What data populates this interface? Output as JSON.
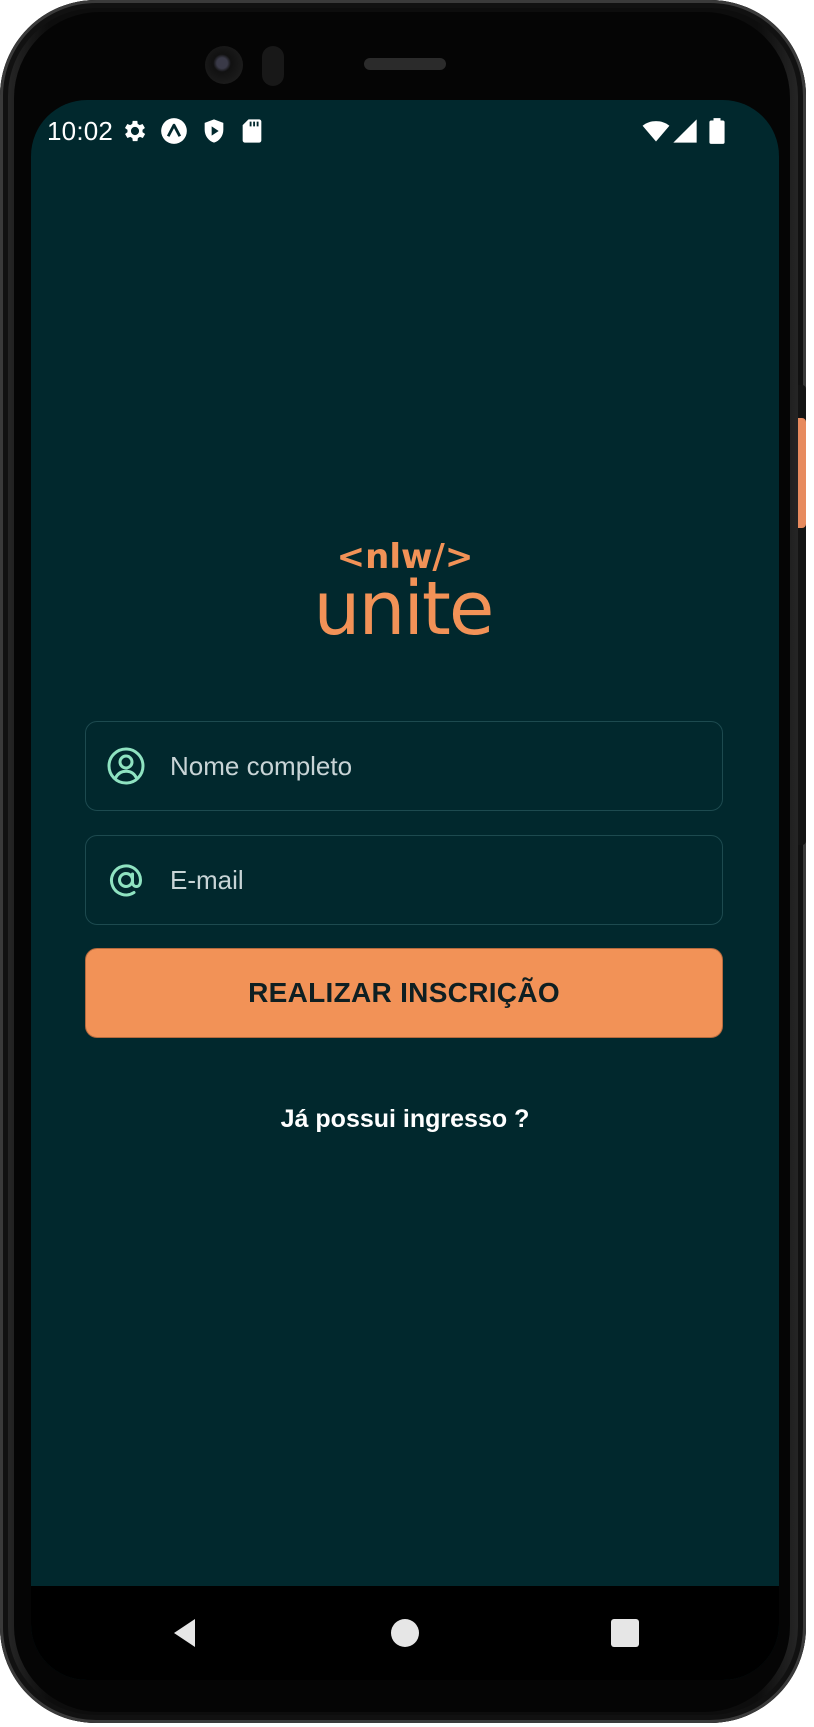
{
  "status_bar": {
    "time": "10:02",
    "left_icons": [
      "gear-icon",
      "expo-icon",
      "play-shield-icon",
      "sd-card-icon"
    ],
    "right_icons": [
      "wifi-icon",
      "cellular-signal-icon",
      "battery-icon"
    ]
  },
  "logo": {
    "top_text": "<nlw/>",
    "main_text": "unite",
    "color": "#f29257"
  },
  "form": {
    "name_field": {
      "placeholder": "Nome completo",
      "value": "",
      "icon": "user-circle-icon"
    },
    "email_field": {
      "placeholder": "E-mail",
      "value": "",
      "icon": "at-sign-icon"
    },
    "submit_label": "REALIZAR INSCRIÇÃO"
  },
  "login_link": "Já possui ingresso ?",
  "nav_bar": {
    "buttons": [
      "back-icon",
      "home-icon",
      "recents-icon"
    ]
  },
  "colors": {
    "background": "#01282d",
    "accent": "#f29257",
    "icon_green": "#8fe3c1",
    "field_border": "#1d4a4f"
  }
}
